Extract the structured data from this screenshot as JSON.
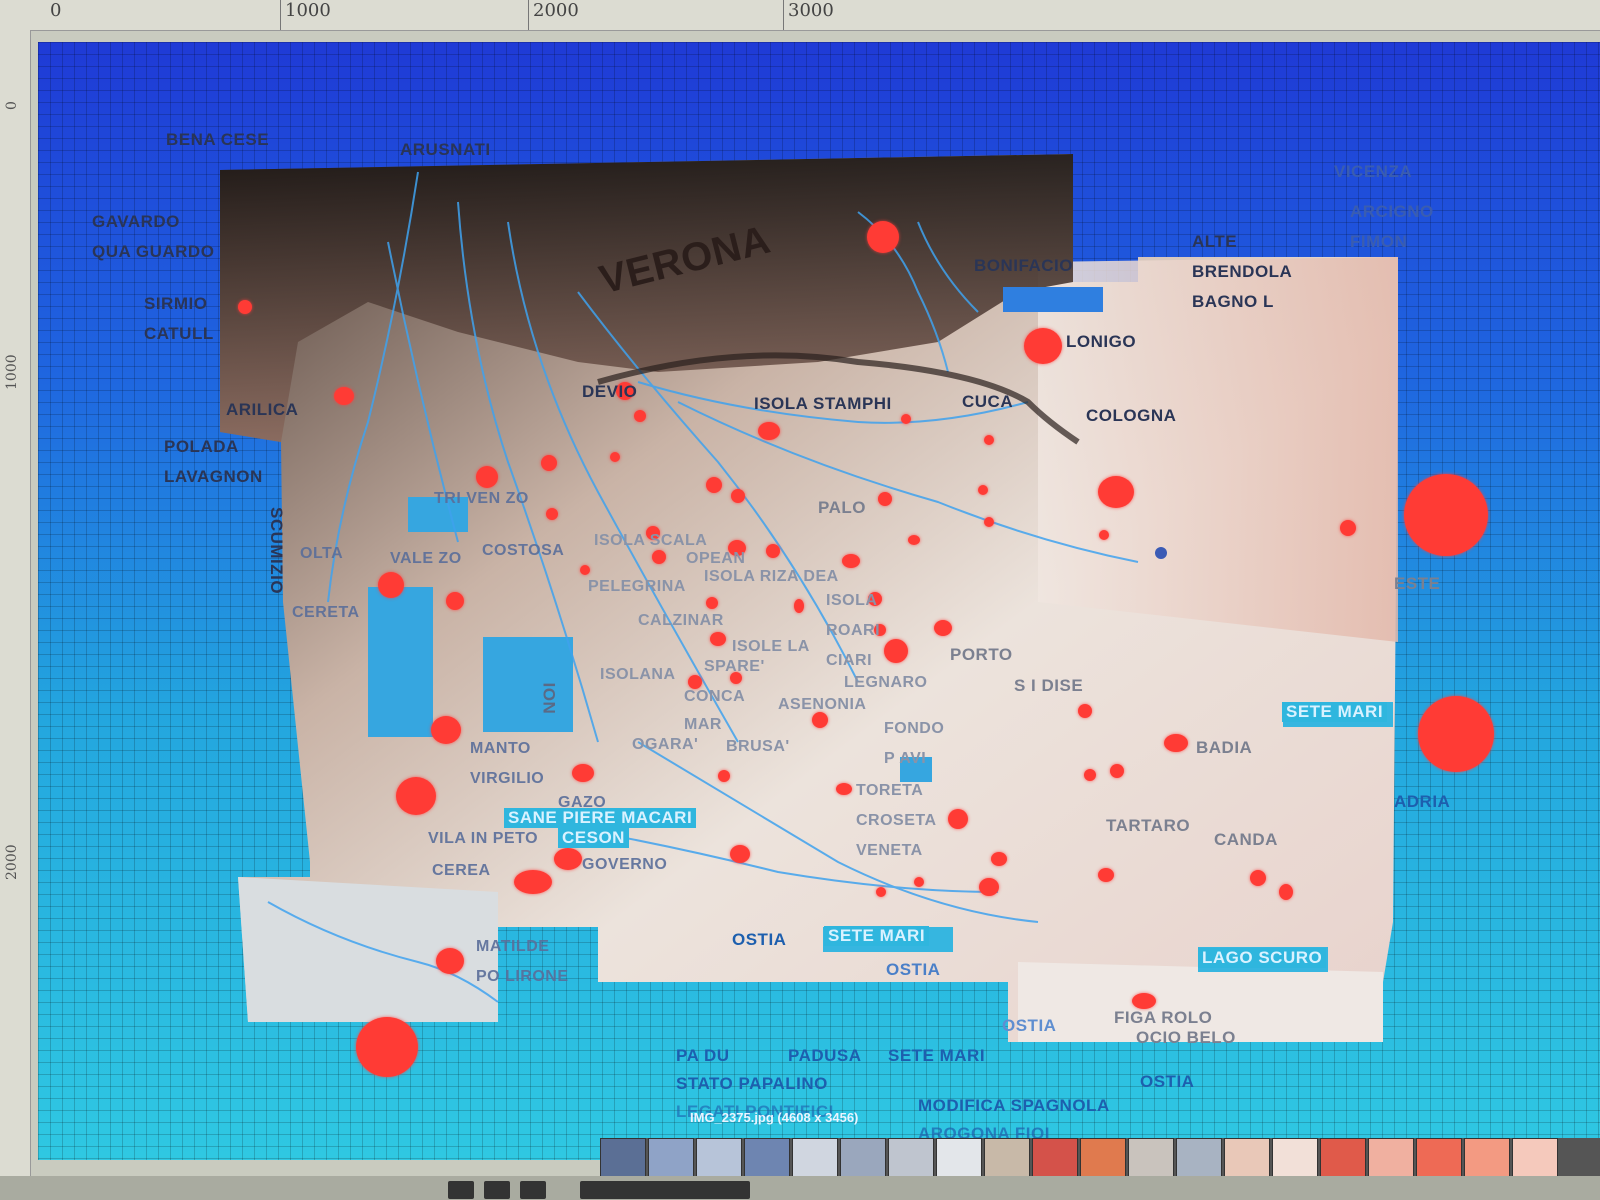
{
  "ruler": {
    "top_ticks": [
      "0",
      "1000",
      "2000",
      "3000"
    ],
    "left_ticks": [
      "0",
      "1000",
      "2000"
    ]
  },
  "image_info": {
    "filename_label": "IMG_2375.jpg (4608 x 3456)"
  },
  "colors": {
    "sea_top": "#1f3ad6",
    "sea_bottom": "#2fc8e2",
    "site_marker": "#ff3b35",
    "label_dark": "#2a3556"
  },
  "places": {
    "bena_cese": "BENA CESE",
    "arusnati": "ARUSNATI",
    "gavardo": "GAVARDO",
    "qua_guardo": "QUA GUARDO",
    "sirmio": "SIRMIO",
    "catull": "CATULL",
    "arilica": "ARILICA",
    "polada": "POLADA",
    "lavagnon": "LAVAGNON",
    "scumizio": "SCUMIZIO",
    "olta": "OLTA",
    "cereta": "CERETA",
    "vale_zo": "VALE ZO",
    "costosa": "COSTOSA",
    "tri_ven_zo": "TRI VEN ZO",
    "verona": "VERONA",
    "devio": "DEVIO",
    "isola_stamphi": "ISOLA STAMPHI",
    "cuca": "CUCA",
    "bonifacio": "BONIFACIO",
    "lonigo": "LONIGO",
    "cologna": "COLOGNA",
    "alte": "ALTE",
    "brendola": "BRENDOLA",
    "bagnol": "BAGNO L",
    "vicenza": "VICENZA",
    "arcigno": "ARCIGNO",
    "fimon": "FIMON",
    "palo": "PALO",
    "isola_scala": "ISOLA SCALA",
    "opean": "OPEAN",
    "pelegrina": "PELEGRINA",
    "isola_riza_dea": "ISOLA RIZA DEA",
    "isola": "ISOLA",
    "calzinar": "CALZINAR",
    "roari": "ROARI",
    "isole_la": "ISOLE LA",
    "spare": "SPARE'",
    "ciari": "CIARI",
    "porto": "PORTO",
    "legnaro": "LEGNARO",
    "isolana": "ISOLANA",
    "conca": "CONCA",
    "s_i_dise": "S I DISE",
    "asenonia": "ASENONIA",
    "noi": "NOI",
    "mar": "MAR",
    "ogara": "OGARA'",
    "brusa": "BRUSA'",
    "fondo": "FONDO",
    "p_avi": "P AVI",
    "manto": "MANTO",
    "virgilio": "VIRGILIO",
    "gazo": "GAZO",
    "sane_piere_macari": "SANE PIERE MACARI",
    "vila_in_peto": "VILA IN PETO",
    "ceson": "CESON",
    "governo": "GOVERNO",
    "cerea": "CEREA",
    "toreta": "TORETA",
    "croseta": "CROSETA",
    "veneta": "VENETA",
    "tartaro": "TARTARO",
    "canda": "CANDA",
    "badia": "BADIA",
    "este": "ESTE",
    "sete_mari_1": "SETE MARI",
    "adria": "ADRIA",
    "matilde": "MATILDE",
    "po_lirone": "PO LIRONE",
    "ostia_1": "OSTIA",
    "sete_mari_2": "SETE MARI",
    "ostia_2": "OSTIA",
    "lago_scuro": "LAGO SCURO",
    "figa_rolo": "FIGA ROLO",
    "ocio_belo": "OCIO BELO",
    "ostia_3": "OSTIA",
    "pa_du": "PA DU",
    "padusa": "PADUSA",
    "sete_mari_3": "SETE MARI",
    "stato_papalino": "STATO PAPALINO",
    "legati_pontifici": "LEGATI PONTIFICI",
    "ostia_4": "OSTIA",
    "modifica_spagnola": "MODIFICA SPAGNOLA",
    "arogona_fioi": "AROGONA FIOI"
  }
}
